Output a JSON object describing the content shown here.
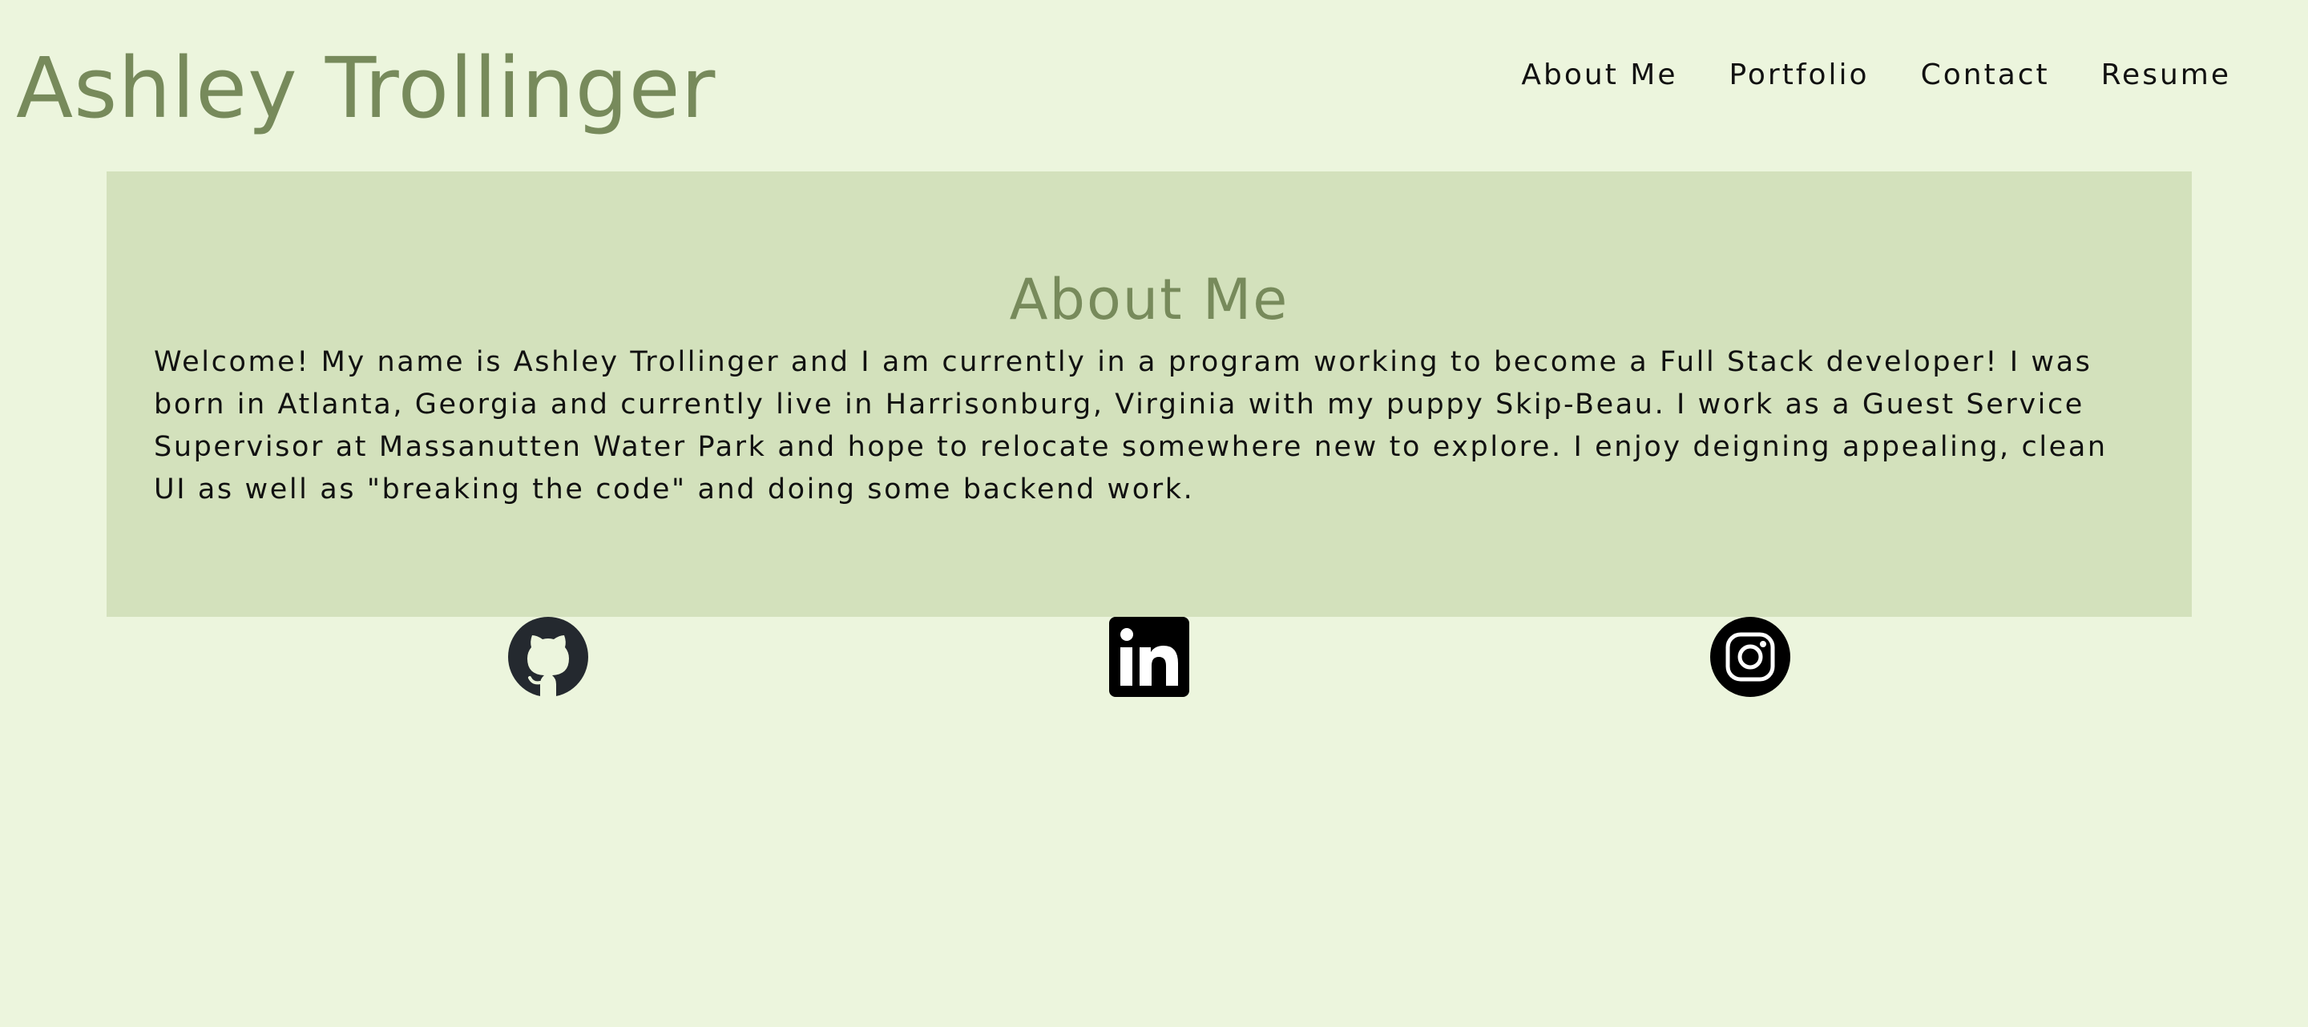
{
  "header": {
    "site_title": "Ashley Trollinger",
    "nav": [
      "About Me",
      "Portfolio",
      "Contact",
      "Resume"
    ]
  },
  "about": {
    "heading": "About Me",
    "body": "Welcome! My name is Ashley Trollinger and I am currently in a program working to become a Full Stack developer! I was born in Atlanta, Georgia and currently live in Harrisonburg, Virginia with my puppy Skip-Beau. I work as a Guest Service Supervisor at Massanutten Water Park and hope to relocate somewhere new to explore. I enjoy deigning appealing, clean UI as well as \"breaking the code\" and doing some backend work."
  },
  "social": {
    "icons": [
      "github-icon",
      "linkedin-icon",
      "instagram-icon"
    ]
  },
  "colors": {
    "page_background": "#ecf5dd",
    "panel_background": "#d3e1bc",
    "accent_text": "#778a5b",
    "body_text": "#111111"
  }
}
